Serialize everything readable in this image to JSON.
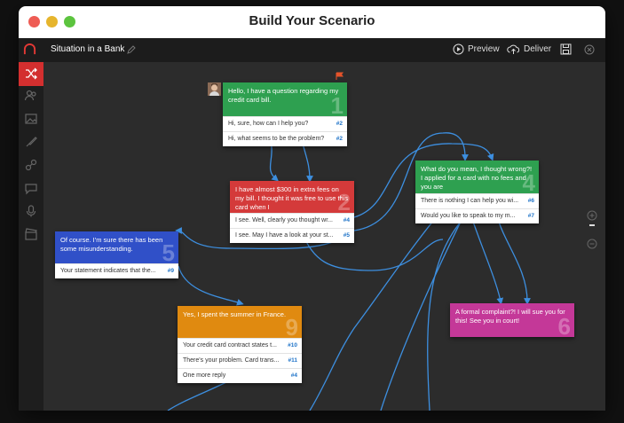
{
  "window": {
    "title": "Build Your Scenario"
  },
  "toolbar": {
    "scenario_name": "Situation in a Bank",
    "preview_label": "Preview",
    "deliver_label": "Deliver"
  },
  "colors": {
    "accent": "#d32f2f",
    "wire": "#3d8fe0",
    "node_green": "#2ea050",
    "node_red": "#d43a3a",
    "node_blue": "#3050c8",
    "node_orange": "#e08a10",
    "node_pink": "#c43898"
  },
  "sidebar": {
    "icons": [
      "branch-icon",
      "people-icon",
      "image-icon",
      "brush-icon",
      "share-icon",
      "chat-icon",
      "microphone-icon",
      "clapperboard-icon"
    ]
  },
  "nodes": [
    {
      "number": "1",
      "text": "Hello, I have a question regarding my credit card bill.",
      "responses": [
        {
          "text": "Hi, sure, how can I help you?",
          "tag": "#2"
        },
        {
          "text": "Hi, what seems to be the problem?",
          "tag": "#2"
        }
      ]
    },
    {
      "number": "2",
      "text": "I have almost $300 in extra fees on my bill. I thought it was free to use this card when I",
      "responses": [
        {
          "text": "I see. Well, clearly you thought wr...",
          "tag": "#4"
        },
        {
          "text": "I see. May I have a look at your st...",
          "tag": "#5"
        }
      ]
    },
    {
      "number": "4",
      "text": "What do you mean, I thought wrong?! I applied for a card with no fees and you are",
      "responses": [
        {
          "text": "There is nothing I can help you wi...",
          "tag": "#6"
        },
        {
          "text": "Would you like to speak to my m...",
          "tag": "#7"
        }
      ]
    },
    {
      "number": "5",
      "text": "Of course. I'm sure there has been some misunderstanding.",
      "responses": [
        {
          "text": "Your statement indicates that the...",
          "tag": "#9"
        }
      ]
    },
    {
      "number": "9",
      "text": "Yes, I spent the summer in France.",
      "responses": [
        {
          "text": "Your credit card contract states t...",
          "tag": "#10"
        },
        {
          "text": "There's your problem. Card trans...",
          "tag": "#11"
        },
        {
          "text": "One more reply",
          "tag": "#4"
        }
      ]
    },
    {
      "number": "6",
      "text": "A formal complaint?! I will sue you for this! See you in court!",
      "responses": []
    }
  ]
}
